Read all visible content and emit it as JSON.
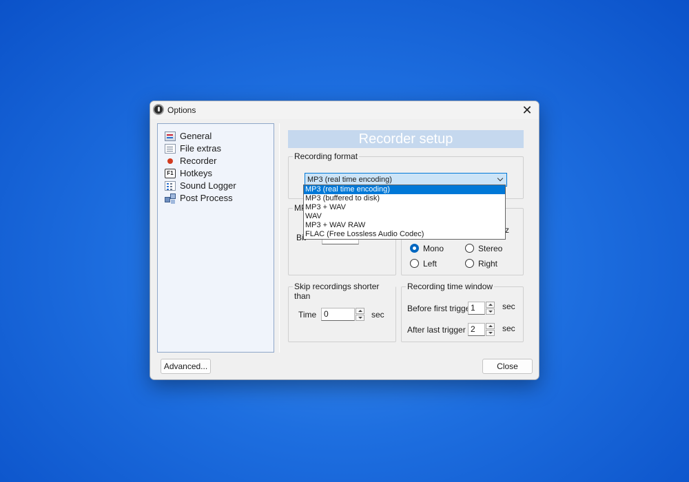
{
  "window": {
    "title": "Options",
    "close_icon": "close-icon"
  },
  "nav": {
    "items": [
      {
        "label": "General",
        "icon": "general-icon"
      },
      {
        "label": "File extras",
        "icon": "file-extras-icon"
      },
      {
        "label": "Recorder",
        "icon": "recorder-icon"
      },
      {
        "label": "Hotkeys",
        "icon": "hotkeys-icon",
        "icon_text": "F1"
      },
      {
        "label": "Sound Logger",
        "icon": "sound-logger-icon"
      },
      {
        "label": "Post Process",
        "icon": "post-process-icon"
      }
    ]
  },
  "content": {
    "header": "Recorder setup",
    "recording_format": {
      "legend": "Recording format",
      "selected": "MP3 (real time encoding)",
      "options": [
        "MP3 (real time encoding)",
        "MP3 (buffered to disk)",
        "MP3 + WAV",
        "WAV",
        "MP3 + WAV RAW",
        "FLAC (Free Lossless Audio Codec)"
      ]
    },
    "mp3": {
      "legend_partial": "MP",
      "bitrate_partial": "Bit"
    },
    "channels": {
      "suffix_partial": "z",
      "mono": "Mono",
      "stereo": "Stereo",
      "left": "Left",
      "right": "Right",
      "selected": "Mono"
    },
    "skip": {
      "legend": "Skip recordings shorter than",
      "time_label": "Time",
      "time_value": "0",
      "unit": "sec"
    },
    "window": {
      "legend": "Recording time window",
      "before_label": "Before first trigger",
      "before_value": "1",
      "before_unit": "sec",
      "after_label": "After last trigger",
      "after_value": "2",
      "after_unit": "sec"
    }
  },
  "buttons": {
    "advanced": "Advanced...",
    "close": "Close"
  }
}
